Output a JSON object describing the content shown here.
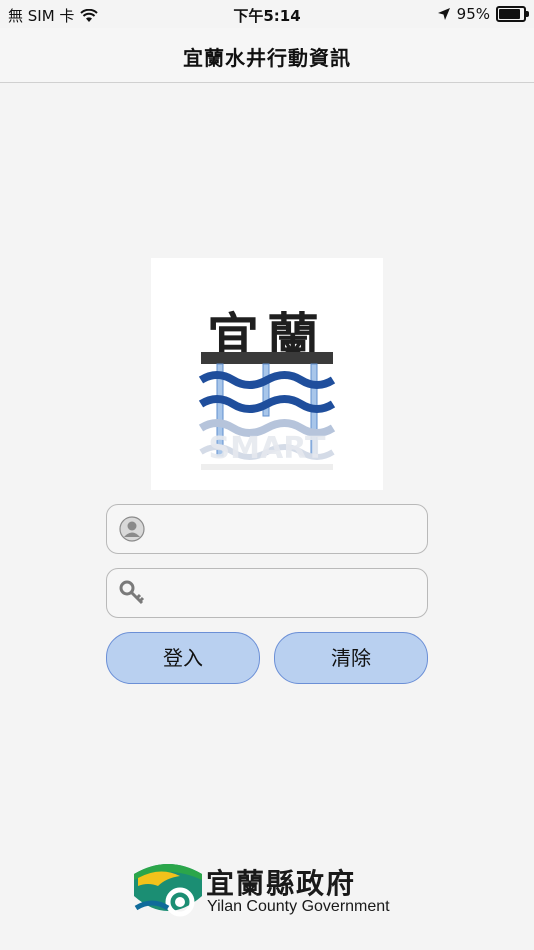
{
  "status_bar": {
    "carrier": "無 SIM 卡",
    "time": "下午5:14",
    "battery": "95%",
    "battery_level": 0.95
  },
  "nav": {
    "title": "宜蘭水井行動資訊"
  },
  "logo": {
    "text": "宜蘭",
    "watermark": "SMART"
  },
  "login": {
    "username_value": "",
    "password_value": "",
    "login_button": "登入",
    "clear_button": "清除"
  },
  "footer": {
    "org_name_cn": "宜蘭縣政府",
    "org_name_en": "Yilan County Government"
  },
  "colors": {
    "accent_blue": "#1f4e9c",
    "button_bg": "#b9d0f0",
    "button_border": "#6b8fd6"
  }
}
